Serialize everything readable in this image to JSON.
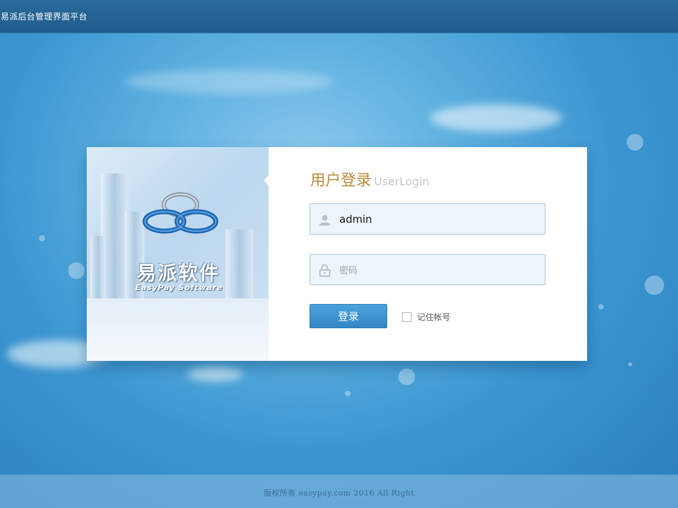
{
  "window": {
    "title": "易派后台管理界面平台"
  },
  "brand": {
    "name": "易派软件",
    "subtitle": "EasyPay Software"
  },
  "login": {
    "title": "用户登录",
    "title_en": "UserLogin",
    "username": {
      "value": "admin",
      "icon": "user-icon"
    },
    "password": {
      "placeholder": "密码",
      "icon": "lock-icon"
    },
    "submit_label": "登录",
    "remember_label": "记住帐号",
    "remember_checked": false
  },
  "footer": {
    "copyright": "版权所有 easypay.com 2016 All Right"
  },
  "colors": {
    "accent": "#3a8fcc",
    "heading": "#b98b3c",
    "topbar": "#24628f"
  }
}
